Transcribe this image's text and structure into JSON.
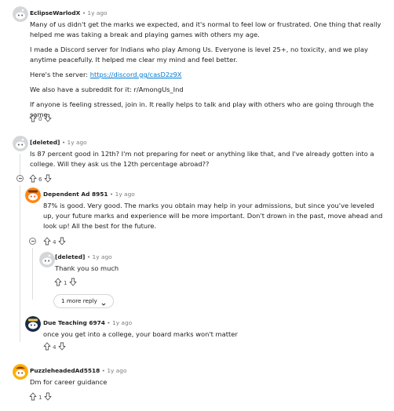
{
  "comments": [
    {
      "author": "EclipseWarlodX",
      "age": "1y ago",
      "paragraphs": [
        "Many of us didn't get the marks we expected, and it's normal to feel low or frustrated. One thing that really helped me was taking a break and playing games with others my age.",
        "I made a Discord server for Indians who play Among Us. Everyone is level 25+, no toxicity, and we play anytime peacefully. It helped me clear my mind and feel better."
      ],
      "server_prefix": "Here's the server: ",
      "server_link": "https://discord.gg/casD2z9X",
      "subreddit_text": "We also have a subreddit for it: r/AmongUs_Ind",
      "closing": "If anyone is feeling stressed, join in. It really helps to talk and play with others who are going through the same.",
      "score": "0"
    },
    {
      "author": "[deleted]",
      "age": "1y ago",
      "text": "Is 87 percent good in 12th? I'm not preparing for neet or anything like that, and I've already gotten into a college. Will they ask us the 12th percentage abroad??",
      "score": "6"
    },
    {
      "author": "Dependent Ad 8951",
      "age": "1y ago",
      "text": "87% is good. Very good. The marks you obtain may help in your admissions, but since you've leveled up, your future marks and experience will be more important. Don't drown in the past, move ahead and look up! All the best for the future.",
      "score": "4"
    },
    {
      "author": "[deleted]",
      "age": "1y ago",
      "text": "Thank you so much",
      "score": "1"
    },
    {
      "author": "Due Teaching 6974",
      "age": "1y ago",
      "text": "once you get into a college, your board marks won't matter",
      "score": "4"
    },
    {
      "author": "PuzzleheadedAd5518",
      "age": "1y ago",
      "text": "Dm for career guidance",
      "score": "1"
    }
  ],
  "more_replies": {
    "label": "1 more reply"
  },
  "separator": "•",
  "colors": {
    "link": "#0079d3",
    "meta_gray": "#7c7c7c",
    "avatar_bg": "#d4d7d9",
    "avatar_orange": "#ff8717"
  },
  "icons": [
    "upvote-icon",
    "downvote-icon",
    "collapse-icon",
    "chevron-down-icon",
    "snoo-avatar-icon"
  ]
}
